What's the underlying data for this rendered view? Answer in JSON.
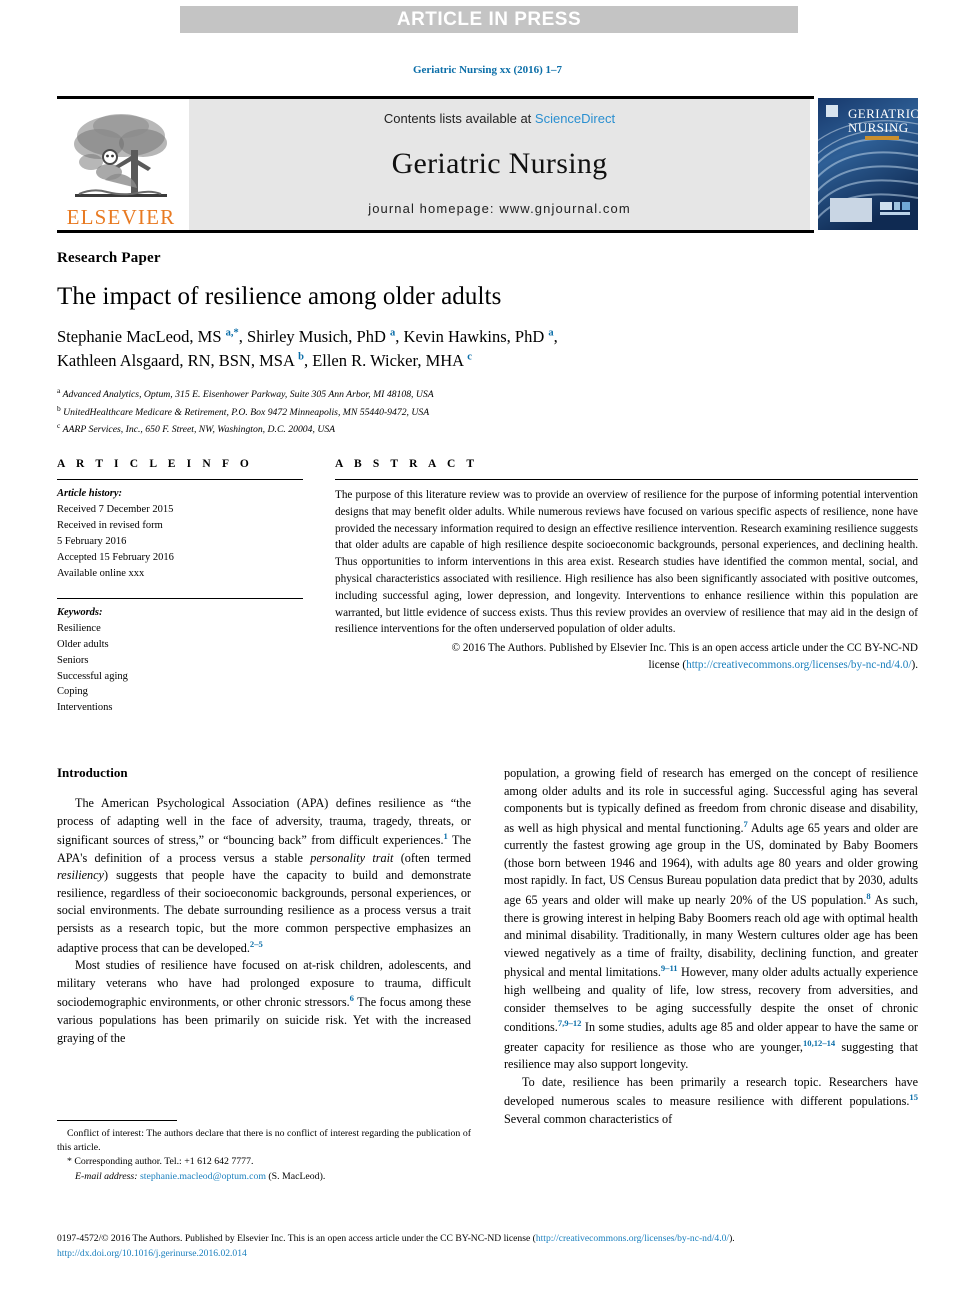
{
  "banner": {
    "label": "ARTICLE IN PRESS"
  },
  "citation": {
    "text": "Geriatric Nursing xx (2016) 1–7",
    "color": "#0b6ea8"
  },
  "masthead": {
    "publisher_logo_word": "ELSEVIER",
    "contents_prefix": "Contents lists available at ",
    "contents_link": "ScienceDirect",
    "journal_title": "Geriatric Nursing",
    "homepage": "journal homepage: www.gnjournal.com",
    "cover_line1": "GERIATRIC",
    "cover_line2": "NURSING"
  },
  "article": {
    "kicker": "Research Paper",
    "title": "The impact of resilience among older adults",
    "authors_html": "Stephanie MacLeod, MS <sup>a,*</sup>, Shirley Musich, PhD <sup>a</sup>, Kevin Hawkins, PhD <sup>a</sup>,<br>Kathleen Alsgaard, RN, BSN, MSA <sup>b</sup>, Ellen R. Wicker, MHA <sup>c</sup>",
    "affiliations": [
      {
        "mark": "a",
        "text": "Advanced Analytics, Optum, 315 E. Eisenhower Parkway, Suite 305 Ann Arbor, MI 48108, USA"
      },
      {
        "mark": "b",
        "text": "UnitedHealthcare Medicare & Retirement, P.O. Box 9472 Minneapolis, MN 55440-9472, USA"
      },
      {
        "mark": "c",
        "text": "AARP Services, Inc., 650 F. Street, NW, Washington, D.C. 20004, USA"
      }
    ]
  },
  "info": {
    "heading": "A R T I C L E   I N F O",
    "history_label": "Article history:",
    "history": [
      "Received 7 December 2015",
      "Received in revised form",
      "5 February 2016",
      "Accepted 15 February 2016",
      "Available online xxx"
    ],
    "keywords_label": "Keywords:",
    "keywords": [
      "Resilience",
      "Older adults",
      "Seniors",
      "Successful aging",
      "Coping",
      "Interventions"
    ]
  },
  "abstract": {
    "heading": "A B S T R A C T",
    "body": "The purpose of this literature review was to provide an overview of resilience for the purpose of informing potential intervention designs that may benefit older adults. While numerous reviews have focused on various specific aspects of resilience, none have provided the necessary information required to design an effective resilience intervention. Research examining resilience suggests that older adults are capable of high resilience despite socioeconomic backgrounds, personal experiences, and declining health. Thus opportunities to inform interventions in this area exist. Research studies have identified the common mental, social, and physical characteristics associated with resilience. High resilience has also been significantly associated with positive outcomes, including successful aging, lower depression, and longevity. Interventions to enhance resilience within this population are warranted, but little evidence of success exists. Thus this review provides an overview of resilience that may aid in the design of resilience interventions for the often underserved population of older adults.",
    "copyright_line": "© 2016 The Authors. Published by Elsevier Inc. This is an open access article under the CC BY-NC-ND",
    "license_prefix": "license (",
    "license_link": "http://creativecommons.org/licenses/by-nc-nd/4.0/",
    "license_suffix": ")."
  },
  "body": {
    "heading": "Introduction",
    "left_paragraphs_html": [
      "The American Psychological Association (APA) defines resilience as “the process of adapting well in the face of adversity, trauma, tragedy, threats, or significant sources of stress,” or “bouncing back” from difficult experiences.<sup>1</sup> The APA's definition of a process versus a stable <i>personality trait</i> (often termed <i>resiliency</i>) suggests that people have the capacity to build and demonstrate resilience, regardless of their socioeconomic backgrounds, personal experiences, or social environments. The debate surrounding resilience as a process versus a trait persists as a research topic, but the more common perspective emphasizes an adaptive process that can be developed.<sup>2–5</sup>",
      "Most studies of resilience have focused on at-risk children, adolescents, and military veterans who have had prolonged exposure to trauma, difficult sociodemographic environments, or other chronic stressors.<sup>6</sup> The focus among these various populations has been primarily on suicide risk. Yet with the increased graying of the"
    ],
    "right_paragraphs_html": [
      "population, a growing field of research has emerged on the concept of resilience among older adults and its role in successful aging. Successful aging has several components but is typically defined as freedom from chronic disease and disability, as well as high physical and mental functioning.<sup>7</sup> Adults age 65 years and older are currently the fastest growing age group in the US, dominated by Baby Boomers (those born between 1946 and 1964), with adults age 80 years and older growing most rapidly. In fact, US Census Bureau population data predict that by 2030, adults age 65 years and older will make up nearly 20% of the US population.<sup>8</sup> As such, there is growing interest in helping Baby Boomers reach old age with optimal health and minimal disability. Traditionally, in many Western cultures older age has been viewed negatively as a time of frailty, disability, declining function, and greater physical and mental limitations.<sup>9–11</sup> However, many older adults actually experience high wellbeing and quality of life, low stress, recovery from adversities, and consider themselves to be aging successfully despite the onset of chronic conditions.<sup>7,9–12</sup> In some studies, adults age 85 and older appear to have the same or greater capacity for resilience as those who are younger,<sup>10,12–14</sup> suggesting that resilience may also support longevity.",
      "To date, resilience has been primarily a research topic. Researchers have developed numerous scales to measure resilience with different populations.<sup>15</sup> Several common characteristics of"
    ]
  },
  "footnotes": {
    "conflict": "Conflict of interest: The authors declare that there is no conflict of interest regarding the publication of this article.",
    "corresponding": "* Corresponding author. Tel.: +1 612 642 7777.",
    "email_label": "E-mail address:",
    "email": "stephanie.macleod@optum.com",
    "email_owner": "(S. MacLeod)."
  },
  "bottom": {
    "issn_copy": "0197-4572/© 2016 The Authors. Published by Elsevier Inc. This is an open access article under the CC BY-NC-ND license (",
    "cc_link": "http://creativecommons.org/licenses/by-nc-nd/4.0/",
    "cc_suffix": ").",
    "doi": "http://dx.doi.org/10.1016/j.gerinurse.2016.02.014"
  }
}
